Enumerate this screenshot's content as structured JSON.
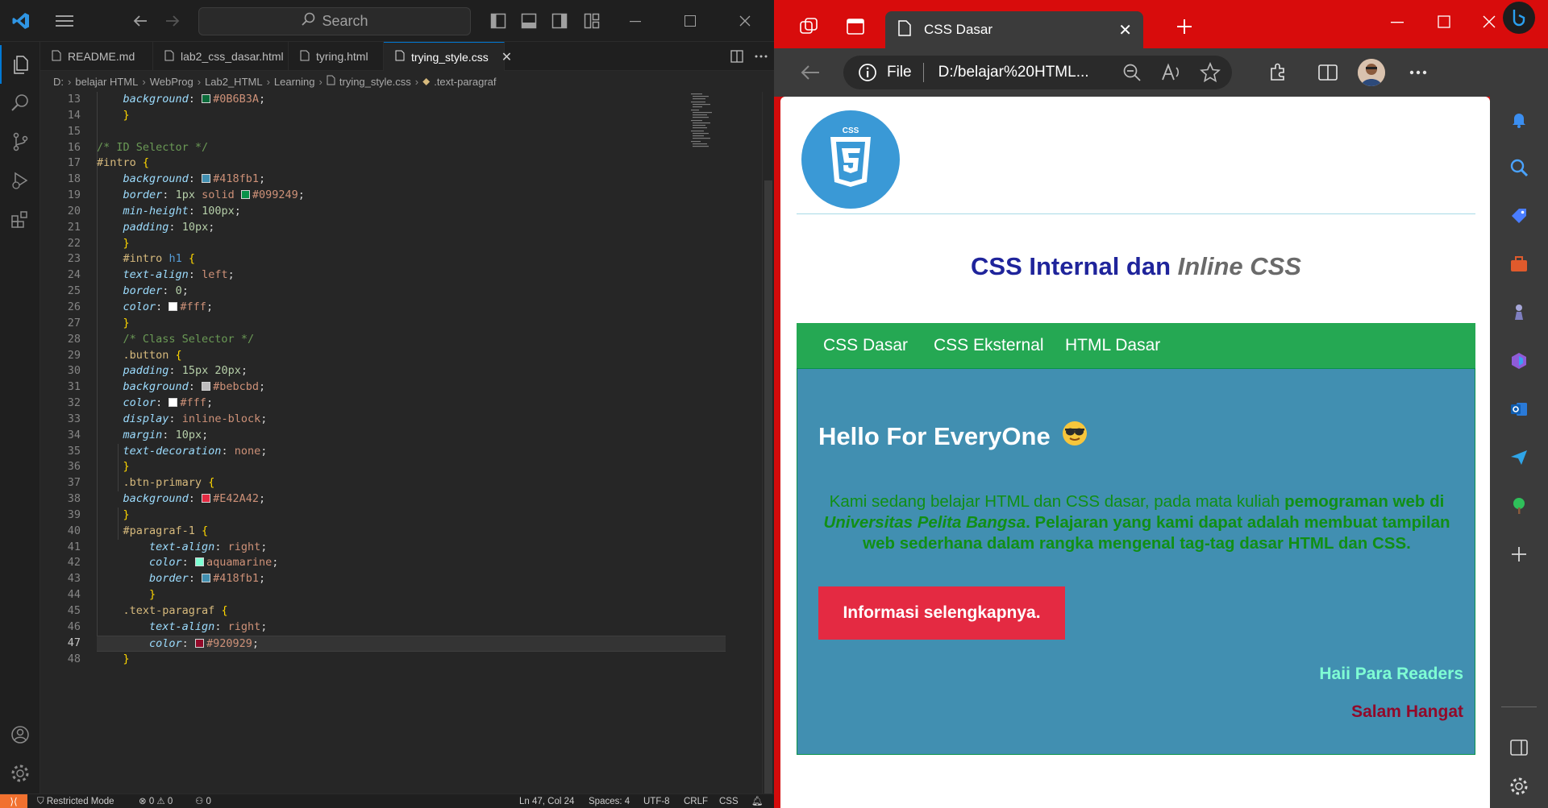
{
  "vscode": {
    "search_placeholder": "Search",
    "tabs": [
      {
        "label": "README.md"
      },
      {
        "label": "lab2_css_dasar.html"
      },
      {
        "label": "tyring.html"
      },
      {
        "label": "trying_style.css"
      }
    ],
    "breadcrumb": [
      "D:",
      "belajar HTML",
      "WebProg",
      "Lab2_HTML",
      "Learning",
      "trying_style.css",
      ".text-paragraf"
    ],
    "line_numbers": [
      "13",
      "14",
      "15",
      "16",
      "17",
      "18",
      "19",
      "20",
      "21",
      "22",
      "23",
      "24",
      "25",
      "26",
      "27",
      "28",
      "29",
      "30",
      "31",
      "32",
      "33",
      "34",
      "35",
      "36",
      "37",
      "38",
      "39",
      "40",
      "41",
      "42",
      "43",
      "44",
      "45",
      "46",
      "47",
      "48"
    ],
    "code": {
      "l13": {
        "prop": "background",
        "val": "#0B6B3A"
      },
      "l16": "/* ID Selector */",
      "l17": "#intro",
      "l18": {
        "prop": "background",
        "val": "#418fb1"
      },
      "l19": {
        "prop": "border",
        "num": "1px",
        "kw": "solid",
        "val": "#099249"
      },
      "l20": {
        "prop": "min-height",
        "num": "100px"
      },
      "l21": {
        "prop": "padding",
        "num": "10px"
      },
      "l23": {
        "id": "#intro",
        "tag": "h1"
      },
      "l24": {
        "prop": "text-align",
        "kw": "left"
      },
      "l25": {
        "prop": "border",
        "num": "0"
      },
      "l26": {
        "prop": "color",
        "val": "#fff"
      },
      "l28": "/* Class Selector */",
      "l29": ".button",
      "l30": {
        "prop": "padding",
        "num": "15px 20px"
      },
      "l31": {
        "prop": "background",
        "val": "#bebcbd"
      },
      "l32": {
        "prop": "color",
        "val": "#fff"
      },
      "l33": {
        "prop": "display",
        "kw": "inline-block"
      },
      "l34": {
        "prop": "margin",
        "num": "10px"
      },
      "l35": {
        "prop": "text-decoration",
        "kw": "none"
      },
      "l37": ".btn-primary",
      "l38": {
        "prop": "background",
        "val": "#E42A42"
      },
      "l40": "#paragraf-1",
      "l41": {
        "prop": "text-align",
        "kw": "right"
      },
      "l42": {
        "prop": "color",
        "kw": "aquamarine"
      },
      "l43": {
        "prop": "border",
        "val": "#418fb1"
      },
      "l45": ".text-paragraf",
      "l46": {
        "prop": "text-align",
        "kw": "right"
      },
      "l47": {
        "prop": "color",
        "val": "#920929"
      }
    },
    "status": {
      "remote": "⟩⟨",
      "restricted": "Restricted Mode",
      "problems": "⊗ 0 ⚠ 0",
      "ports": "⚇ 0",
      "position": "Ln 47, Col 24",
      "spaces": "Spaces: 4",
      "encoding": "UTF-8",
      "eol": "CRLF",
      "language": "CSS"
    }
  },
  "edge": {
    "tab_title": "CSS Dasar",
    "address_label": "File",
    "address_url": "D:/belajar%20HTML...",
    "page": {
      "logo_text": "CSS",
      "title_main": "CSS Internal dan ",
      "title_em": "Inline CSS",
      "nav": [
        "CSS Dasar",
        "CSS Eksternal",
        "HTML Dasar"
      ],
      "heading": "Hello For EveryOne",
      "para_plain": "Kami sedang belajar HTML dan CSS dasar, pada mata kuliah ",
      "para_bold1": "pemograman web di ",
      "para_bolditalic": "Universitas Pelita Bangsa",
      "para_bold2": ". Pelajaran yang kami dapat adalah membuat tampilan web sederhana dalam rangka mengenal tag-tag dasar HTML dan CSS.",
      "button": "Informasi selengkapnya.",
      "right_text_1": "Haii Para Readers",
      "right_text_2": "Salam Hangat"
    }
  },
  "colors": {
    "vscode_bg": "#262626",
    "edge_frame": "#d80c0c",
    "nav_green": "#25a853",
    "intro_bg": "#418fb1",
    "btn_primary": "#E42A42",
    "aquamarine": "#7fffd4",
    "text_paragraf": "#920929",
    "title_blue": "#1f249b"
  }
}
